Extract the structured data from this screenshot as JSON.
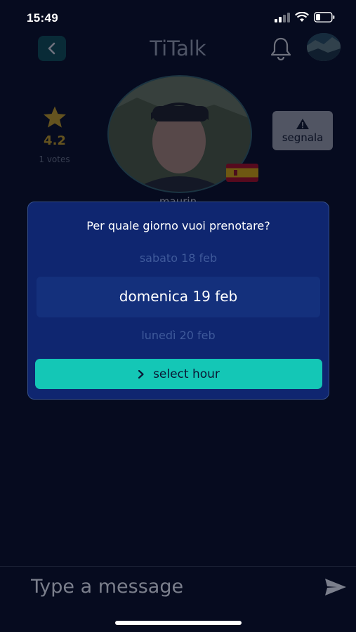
{
  "status_bar": {
    "time": "15:49"
  },
  "header": {
    "title": "TiTalk"
  },
  "profile": {
    "rating": "4.2",
    "votes": "1 votes",
    "username": "maurin",
    "report_label": "segnala"
  },
  "modal": {
    "title": "Per quale giorno vuoi prenotare?",
    "days": [
      "sabato 18 feb",
      "domenica 19 feb",
      "lunedì 20 feb"
    ],
    "select_label": "select hour"
  },
  "composer": {
    "placeholder": "Type a message"
  },
  "colors": {
    "background": "#060b1f",
    "modal": "#0f2670",
    "accent": "#14c7b6",
    "rating": "#e8b820"
  }
}
